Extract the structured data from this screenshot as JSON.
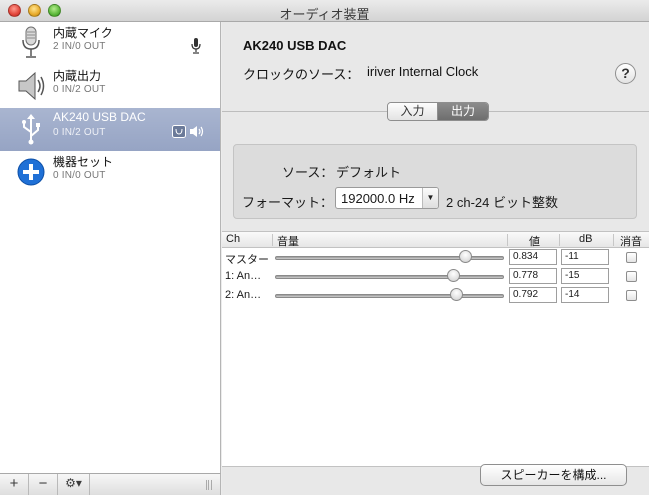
{
  "window": {
    "title": "オーディオ装置"
  },
  "devices": [
    {
      "name": "内蔵マイク",
      "io": "2 IN/0 OUT"
    },
    {
      "name": "内蔵出力",
      "io": "0 IN/2 OUT"
    },
    {
      "name": "AK240 USB DAC",
      "io": "0 IN/2 OUT"
    },
    {
      "name": "機器セット",
      "io": "0 IN/0 OUT"
    }
  ],
  "sidebar_toolbar": {
    "add": "+",
    "remove": "−",
    "gear": "⚙▾"
  },
  "detail": {
    "device_title": "AK240 USB DAC",
    "clock_label": "クロックのソース：",
    "clock_value": "iriver Internal Clock",
    "help": "?"
  },
  "tabs": {
    "input": "入力",
    "output": "出力"
  },
  "format": {
    "source_label": "ソース：",
    "source_value": "デフォルト",
    "format_label": "フォーマット：",
    "format_value": "192000.0 Hz",
    "format_detail": "2 ch-24 ビット整数"
  },
  "table": {
    "headers": {
      "ch": "Ch",
      "volume": "音量",
      "value": "値",
      "db": "dB",
      "mute": "消音"
    },
    "rows": [
      {
        "name": "マスター",
        "value": "0.834",
        "db": "-11",
        "level": 0.834,
        "muted": false
      },
      {
        "name": "1: An…",
        "value": "0.778",
        "db": "-15",
        "level": 0.778,
        "muted": false
      },
      {
        "name": "2: An…",
        "value": "0.792",
        "db": "-14",
        "level": 0.792,
        "muted": false
      }
    ]
  },
  "configure_button": "スピーカーを構成..."
}
